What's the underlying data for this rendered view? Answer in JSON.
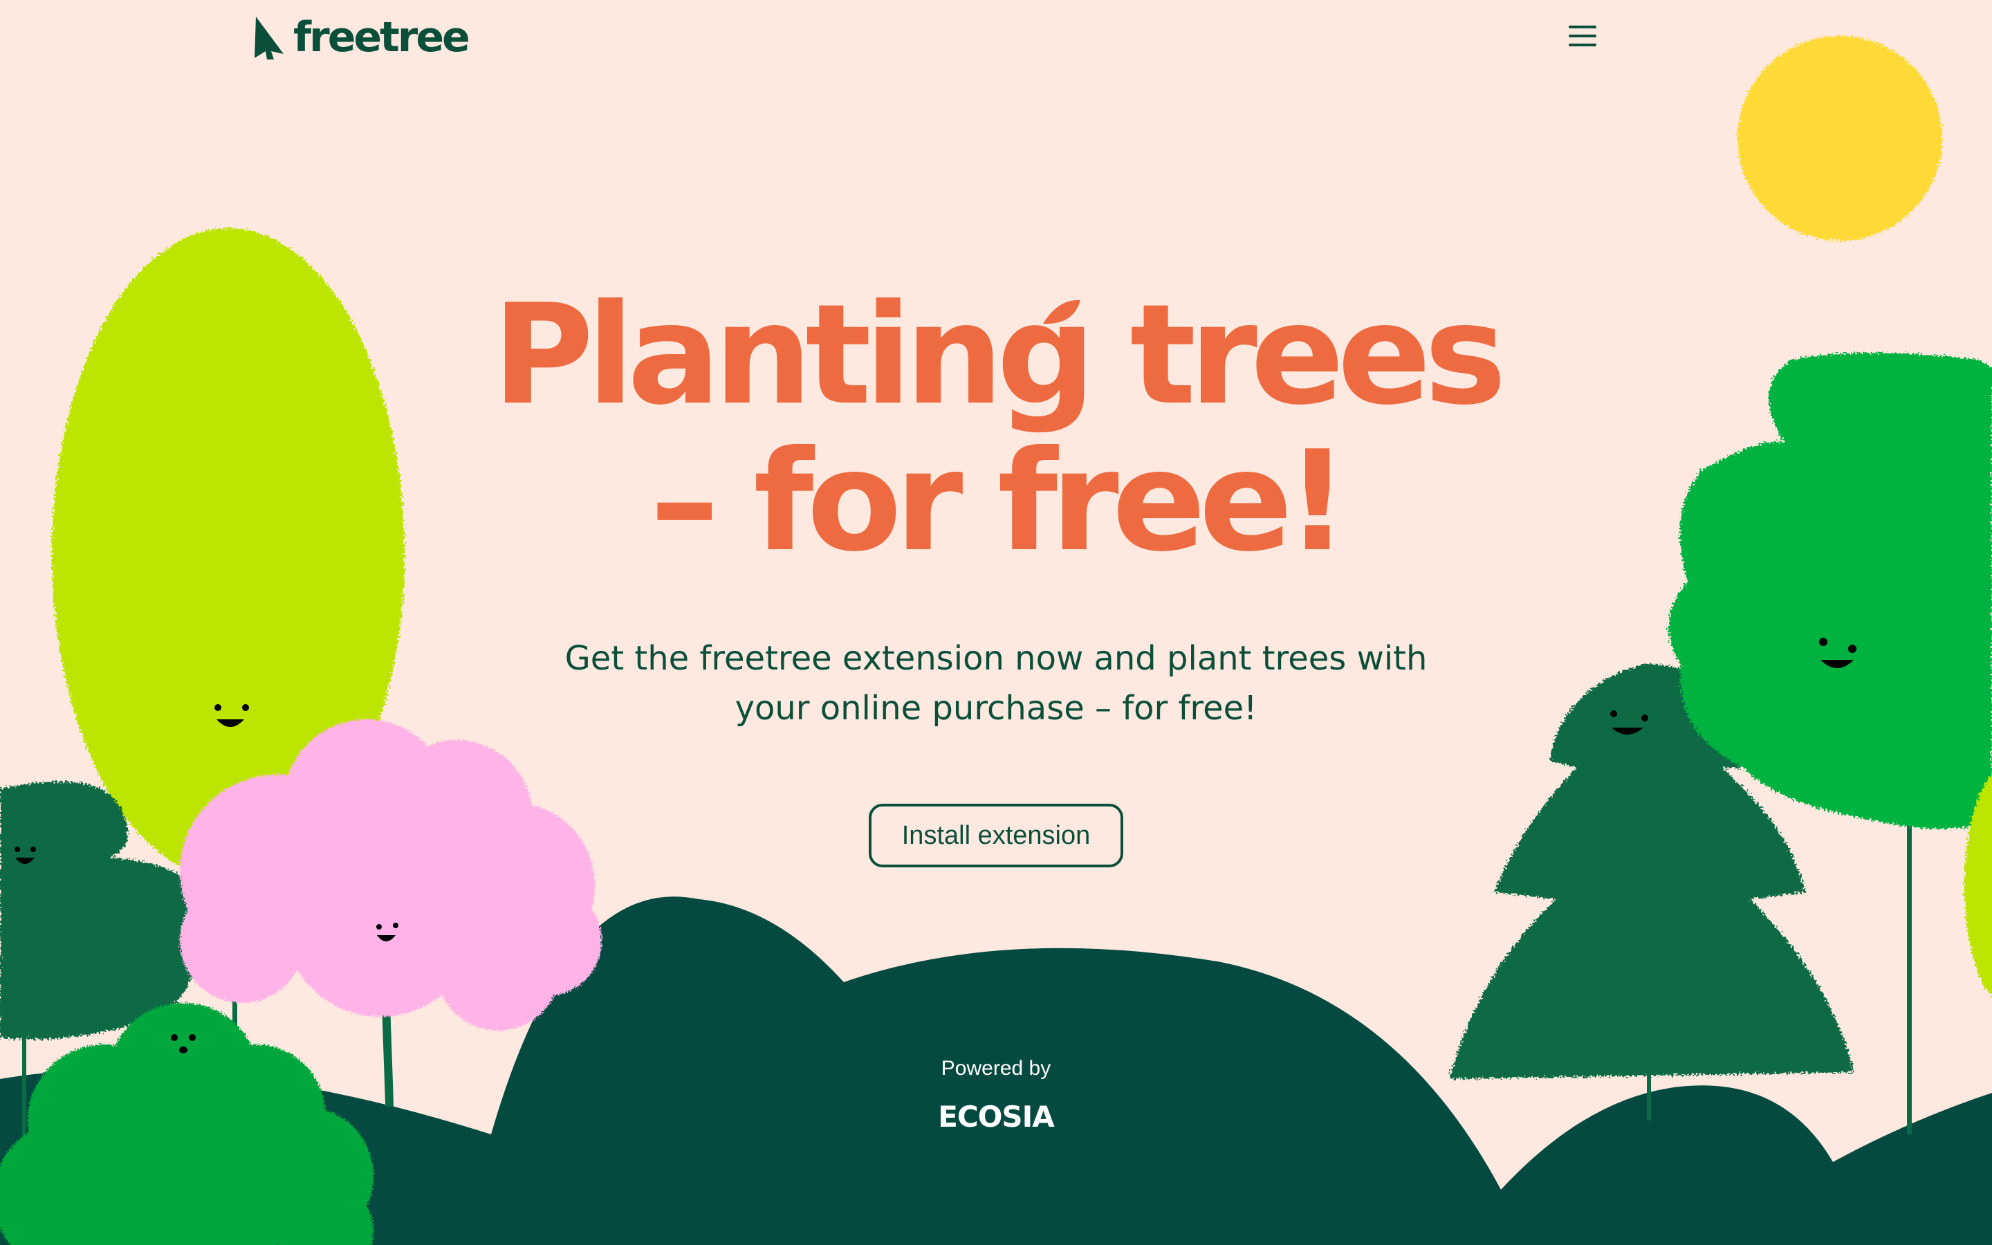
{
  "header": {
    "logo_text": "freetree",
    "menu_icon": "hamburger-menu-icon"
  },
  "hero": {
    "title_line1": "Planting trees",
    "title_line2": "– for free!",
    "subtitle_line1": "Get the freetree extension now and plant trees with",
    "subtitle_line2": "your online purchase – for free!",
    "install_label": "Install extension"
  },
  "footer": {
    "powered_by": "Powered by",
    "brand": "ECOSIA"
  },
  "colors": {
    "background": "#FDE9E0",
    "accent": "#EE6A40",
    "dark_green": "#0B4F3B",
    "hill_green": "#054A40",
    "lime": "#BCE600",
    "pink": "#FFB3E6",
    "bright_green": "#00A73C",
    "sun": "#FFD935"
  }
}
